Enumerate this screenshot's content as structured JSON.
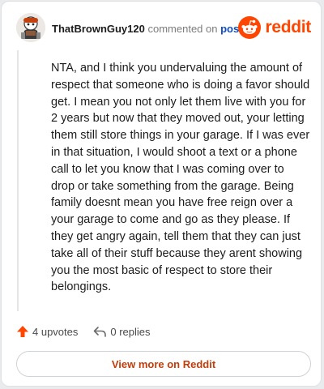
{
  "comment": {
    "author": "ThatBrownGuy120",
    "action_text": "commented on",
    "target_text": "post",
    "brand": "reddit",
    "body": "NTA, and I think you undervaluing the amount of respect that someone who is doing a favor should get. I mean you not only let them live with you for 2 years but now that they moved out, your letting them still store things in your garage. If I was ever in that situation, I would shoot a text or a phone call to let you know that I was coming over to drop or take something from the garage. Being family doesnt mean you have free reign over a your garage to come and go as they please. If they get angry again, tell them that they can just take all of their stuff because they arent showing you the most basic of respect to store their belongings.",
    "upvotes": "4 upvotes",
    "replies": "0 replies",
    "view_more": "View more on Reddit"
  },
  "icons": {
    "avatar": "user-avatar-icon",
    "brand": "reddit-snoo-icon",
    "upvote": "upvote-arrow-icon",
    "reply": "reply-arrow-icon"
  },
  "colors": {
    "brand": "#ff4500",
    "link": "#0f4cc4",
    "cta": "#c33d0b",
    "text": "#1c1c1c",
    "muted": "#7c7c7c"
  }
}
